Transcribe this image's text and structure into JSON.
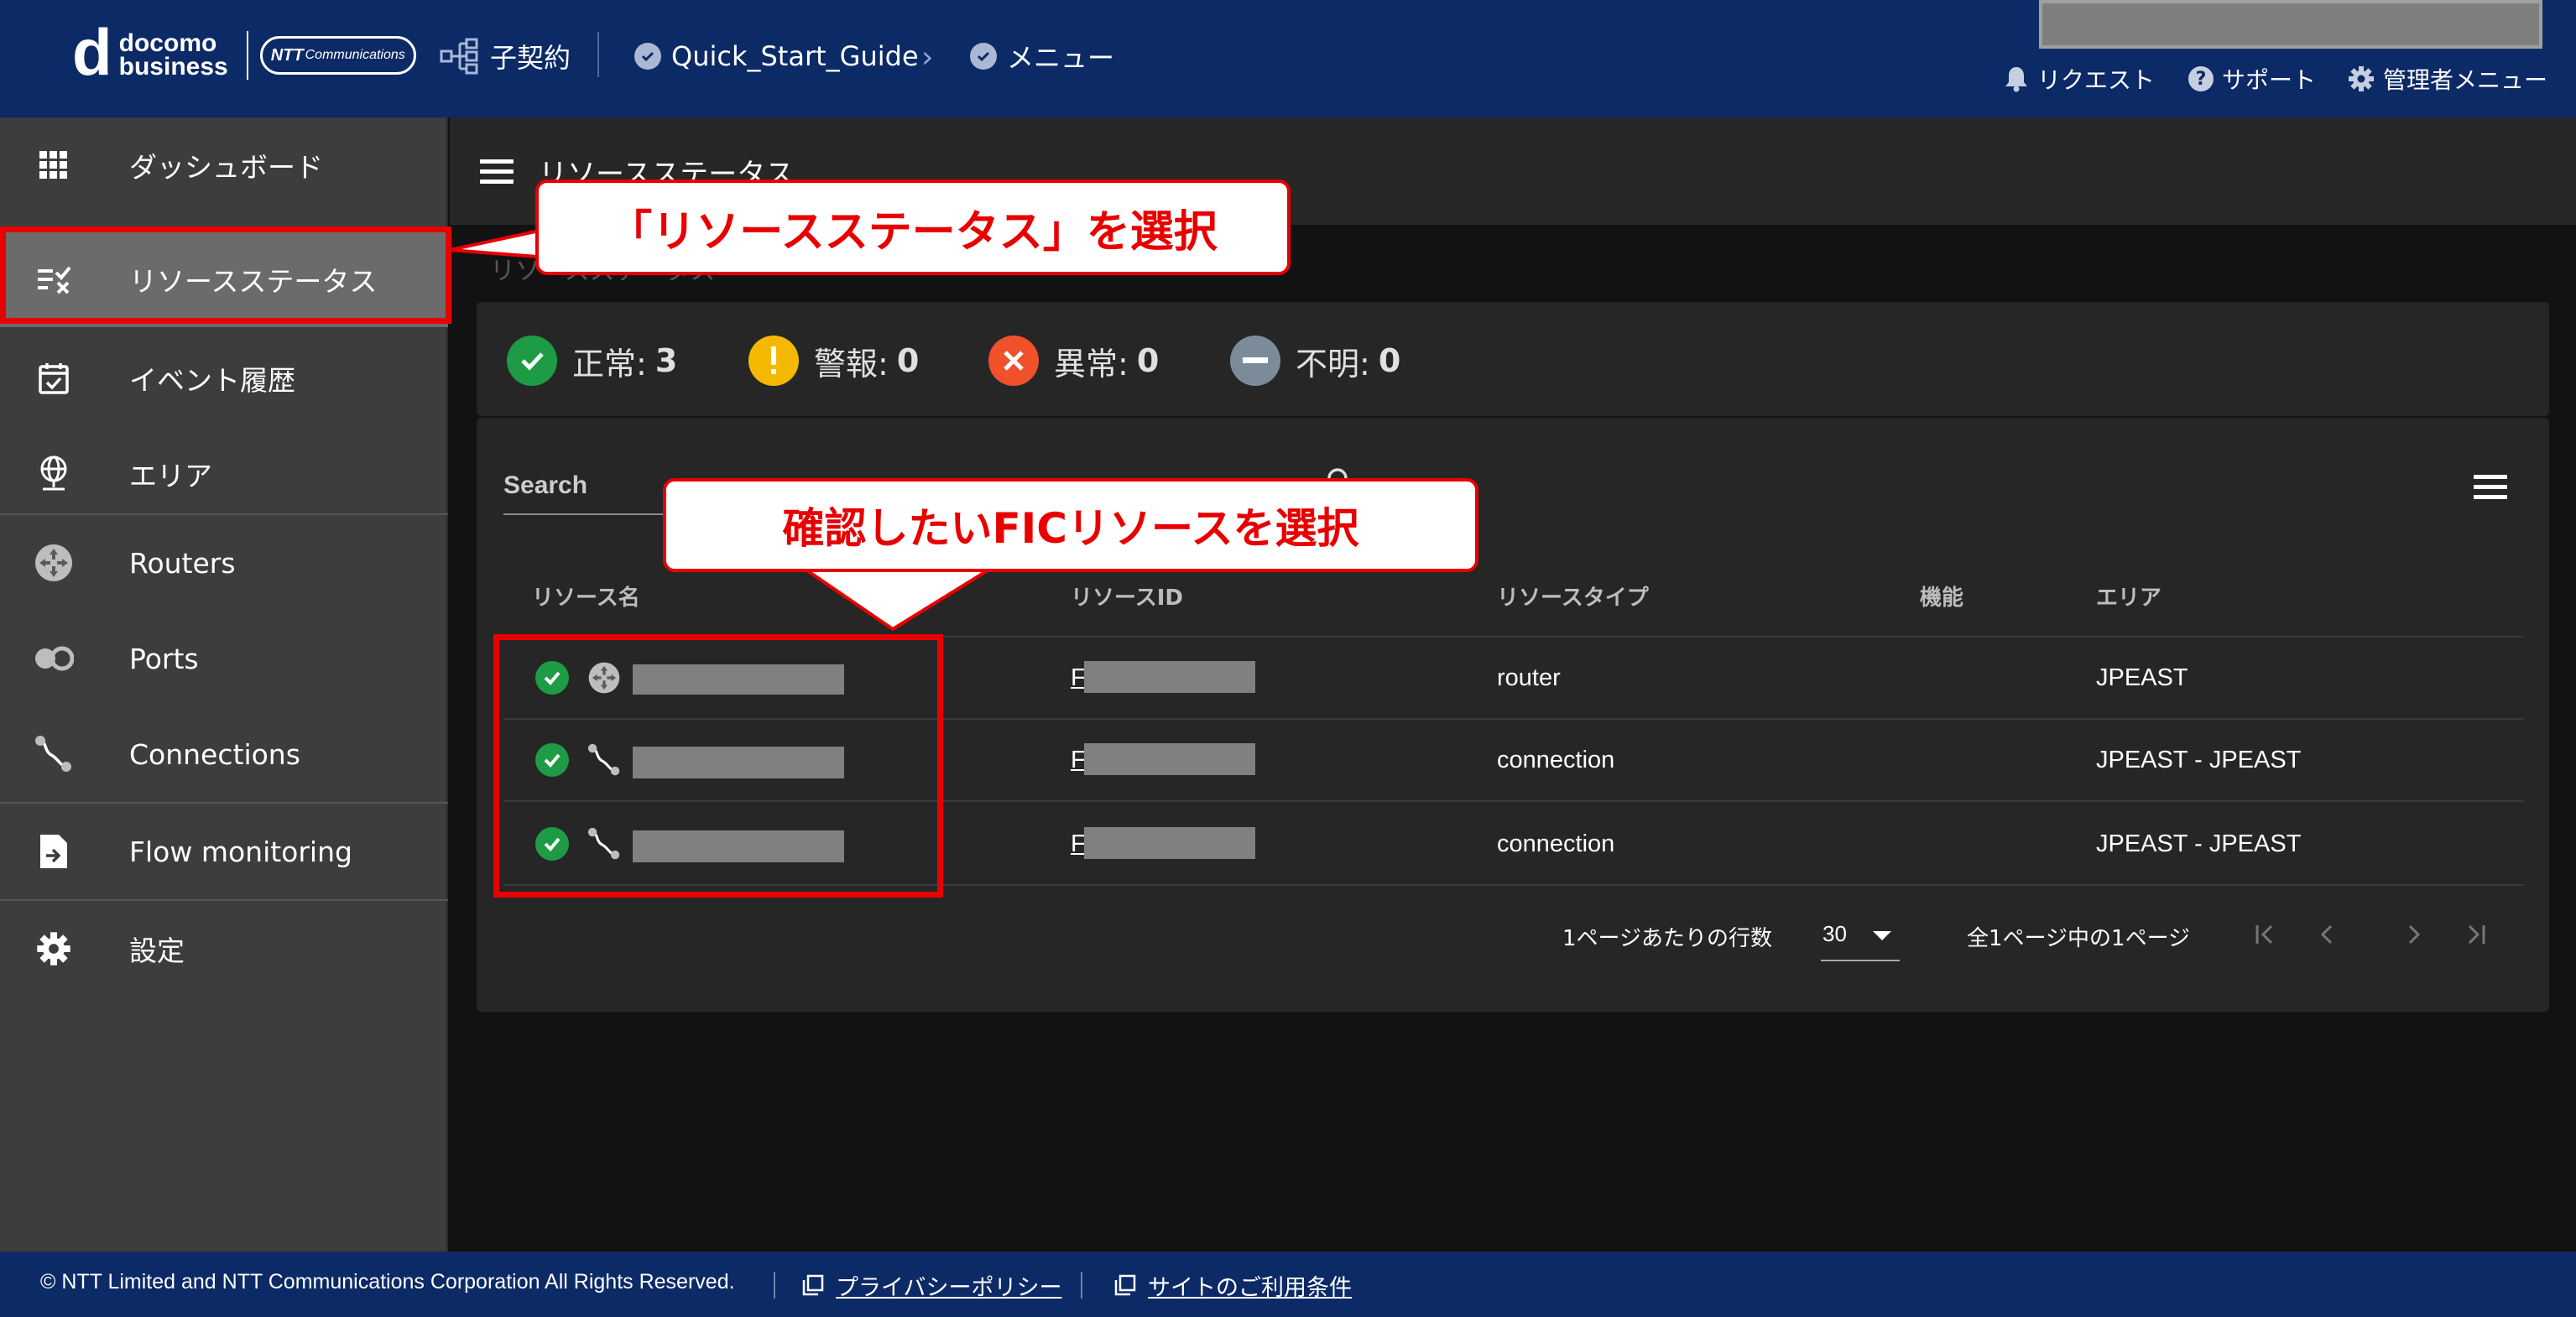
{
  "header": {
    "logo_line1": "docomo",
    "logo_line2": "business",
    "logo_partner_main": "NTT",
    "logo_partner_sub": "Communications",
    "crumbs": [
      {
        "label": "子契約",
        "icon": "org-tree-icon"
      },
      {
        "label": "Quick_Start_Guide",
        "icon": "check-circle-icon"
      },
      {
        "label": "メニュー",
        "icon": "check-circle-icon"
      }
    ],
    "crumb_separator": "›",
    "links": [
      {
        "label": "リクエスト",
        "icon": "bell-icon"
      },
      {
        "label": "サポート",
        "icon": "help-icon"
      },
      {
        "label": "管理者メニュー",
        "icon": "gear-icon"
      }
    ],
    "help_glyph": "?"
  },
  "sidebar": {
    "items": [
      {
        "label": "ダッシュボード",
        "icon": "grid-icon"
      },
      {
        "label": "リソースステータス",
        "icon": "checklist-icon",
        "active": true
      },
      {
        "label": "イベント履歴",
        "icon": "calendar-check-icon"
      },
      {
        "label": "エリア",
        "icon": "globe-pin-icon"
      },
      {
        "label": "Routers",
        "icon": "router-icon"
      },
      {
        "label": "Ports",
        "icon": "port-icon"
      },
      {
        "label": "Connections",
        "icon": "connection-icon"
      },
      {
        "label": "Flow monitoring",
        "icon": "file-export-icon"
      },
      {
        "label": "設定",
        "icon": "gear-icon"
      }
    ]
  },
  "main": {
    "title": "リソースステータス",
    "breadcrumb": "リソースステータス",
    "summary": [
      {
        "label": "正常:",
        "count": "3",
        "color": "#1e9b45",
        "icon": "check-circle-icon"
      },
      {
        "label": "警報:",
        "count": "0",
        "color": "#f5b800",
        "icon": "warning-icon"
      },
      {
        "label": "異常:",
        "count": "0",
        "color": "#f0502a",
        "icon": "error-icon"
      },
      {
        "label": "不明:",
        "count": "0",
        "color": "#7c8b9a",
        "icon": "unknown-icon"
      }
    ],
    "search_label": "Search",
    "table": {
      "columns": [
        "リソース名",
        "リソースID",
        "リソースタイプ",
        "機能",
        "エリア"
      ],
      "rows": [
        {
          "id_prefix": "F",
          "type": "router",
          "function": "",
          "area": "JPEAST",
          "icon": "router-icon"
        },
        {
          "id_prefix": "F",
          "type": "connection",
          "function": "",
          "area": "JPEAST - JPEAST",
          "icon": "connection-icon"
        },
        {
          "id_prefix": "F",
          "type": "connection",
          "function": "",
          "area": "JPEAST - JPEAST",
          "icon": "connection-icon"
        }
      ]
    },
    "pager": {
      "rows_per_page_label": "1ページあたりの行数",
      "rows_per_page_value": "30",
      "page_info": "全1ページ中の1ページ"
    }
  },
  "callouts": {
    "sidebar": "「リソースステータス」を選択",
    "table": "確認したいFICリソースを選択"
  },
  "footer": {
    "copyright": "© NTT Limited and NTT Communications Corporation All Rights Reserved.",
    "links": [
      "プライバシーポリシー",
      "サイトのご利用条件"
    ]
  },
  "colors": {
    "header_bg": "#0c2a66",
    "sidebar_bg": "#3d3d3d",
    "sidebar_active_bg": "#6b6b6b",
    "card_bg": "#262626",
    "callout_red": "#e80000"
  }
}
